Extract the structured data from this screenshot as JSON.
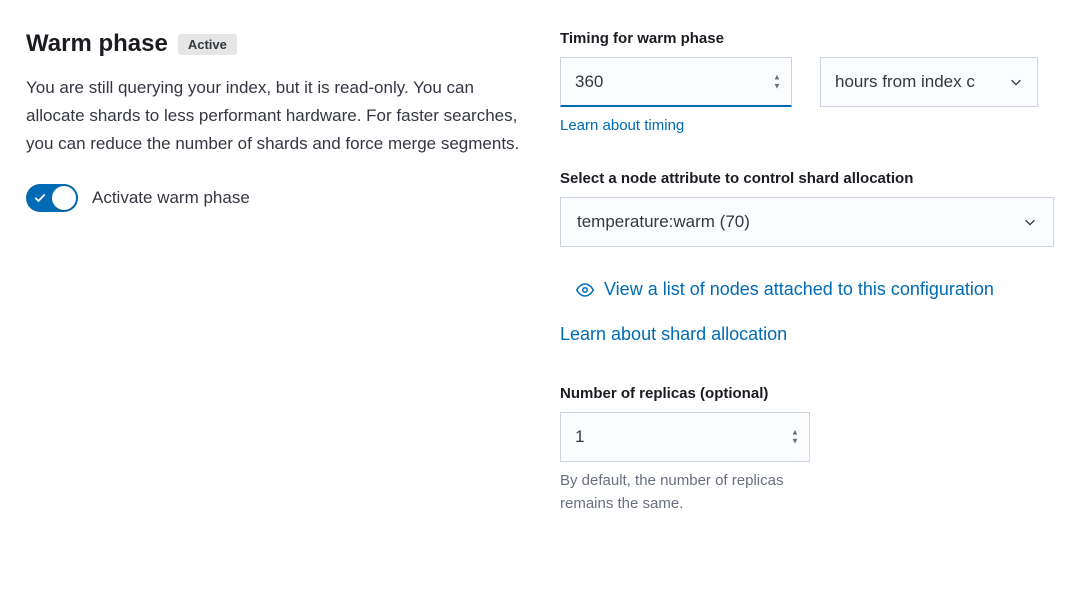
{
  "header": {
    "title": "Warm phase",
    "badge": "Active",
    "description": "You are still querying your index, but it is read-only. You can allocate shards to less performant hardware. For faster searches, you can reduce the number of shards and force merge segments."
  },
  "toggle": {
    "label": "Activate warm phase",
    "active": true
  },
  "timing": {
    "label": "Timing for warm phase",
    "value": "360",
    "unit": "hours from index c",
    "learn_link": "Learn about timing"
  },
  "allocation": {
    "label": "Select a node attribute to control shard allocation",
    "value": "temperature:warm (70)",
    "nodes_link": "View a list of nodes attached to this configuration",
    "learn_link": "Learn about shard allocation"
  },
  "replicas": {
    "label": "Number of replicas (optional)",
    "value": "1",
    "help": "By default, the number of replicas remains the same."
  }
}
